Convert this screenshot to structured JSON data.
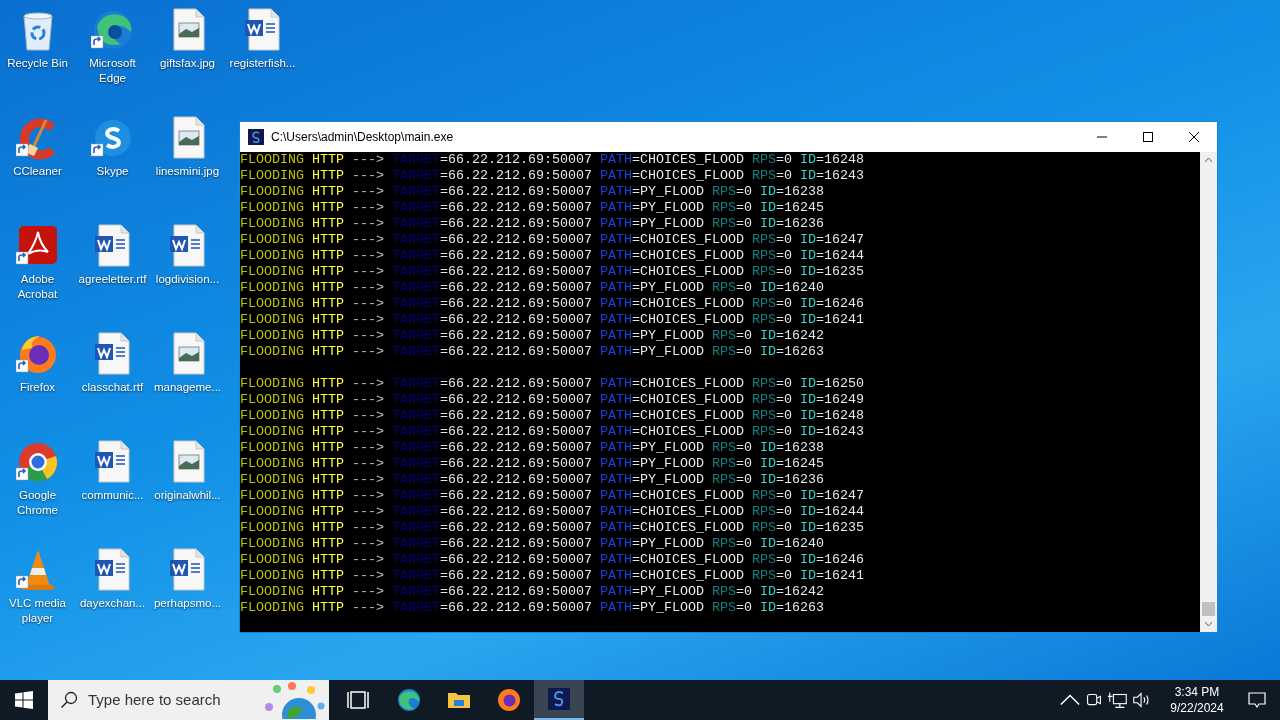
{
  "desktop_icons": [
    {
      "label": "Recycle Bin",
      "kind": "recycle",
      "shortcut": false
    },
    {
      "label": "CCleaner",
      "kind": "ccleaner",
      "shortcut": true
    },
    {
      "label": "Adobe Acrobat",
      "kind": "pdf",
      "shortcut": true
    },
    {
      "label": "Firefox",
      "kind": "firefox",
      "shortcut": true
    },
    {
      "label": "Google Chrome",
      "kind": "chrome",
      "shortcut": true
    },
    {
      "label": "VLC media player",
      "kind": "vlc",
      "shortcut": true
    },
    {
      "label": "Microsoft Edge",
      "kind": "edge",
      "shortcut": true
    },
    {
      "label": "Skype",
      "kind": "skype",
      "shortcut": true
    },
    {
      "label": "agreeletter.rtf",
      "kind": "word",
      "shortcut": false
    },
    {
      "label": "classchat.rtf",
      "kind": "word",
      "shortcut": false
    },
    {
      "label": "communic...",
      "kind": "word",
      "shortcut": false
    },
    {
      "label": "dayexchan...",
      "kind": "word",
      "shortcut": false
    },
    {
      "label": "giftsfax.jpg",
      "kind": "image",
      "shortcut": false
    },
    {
      "label": "linesmini.jpg",
      "kind": "image",
      "shortcut": false
    },
    {
      "label": "logdivision...",
      "kind": "word",
      "shortcut": false
    },
    {
      "label": "manageme...",
      "kind": "image",
      "shortcut": false
    },
    {
      "label": "originalwhil...",
      "kind": "image",
      "shortcut": false
    },
    {
      "label": "perhapsmo...",
      "kind": "word",
      "shortcut": false
    },
    {
      "label": "registerfish...",
      "kind": "word",
      "shortcut": false
    }
  ],
  "console_window": {
    "title": "C:\\Users\\admin\\Desktop\\main.exe",
    "buttons": [
      {
        "kind": "minimize"
      },
      {
        "kind": "maximize"
      },
      {
        "kind": "close"
      }
    ],
    "lines": [
      {
        "kind": "text",
        "parts": [
          "FLOODING",
          "HTTP",
          "--->",
          "TARGET",
          "=66.22.212.69:50007",
          "PATH",
          "=CHOICES_FLOOD",
          "RPS",
          "=0",
          "ID",
          "=16248"
        ]
      },
      {
        "kind": "text",
        "parts": [
          "FLOODING",
          "HTTP",
          "--->",
          "TARGET",
          "=66.22.212.69:50007",
          "PATH",
          "=CHOICES_FLOOD",
          "RPS",
          "=0",
          "ID",
          "=16243"
        ]
      },
      {
        "kind": "text",
        "parts": [
          "FLOODING",
          "HTTP",
          "--->",
          "TARGET",
          "=66.22.212.69:50007",
          "PATH",
          "=PY_FLOOD",
          "RPS",
          "=0",
          "ID",
          "=16238"
        ]
      },
      {
        "kind": "text",
        "parts": [
          "FLOODING",
          "HTTP",
          "--->",
          "TARGET",
          "=66.22.212.69:50007",
          "PATH",
          "=PY_FLOOD",
          "RPS",
          "=0",
          "ID",
          "=16245"
        ]
      },
      {
        "kind": "text",
        "parts": [
          "FLOODING",
          "HTTP",
          "--->",
          "TARGET",
          "=66.22.212.69:50007",
          "PATH",
          "=PY_FLOOD",
          "RPS",
          "=0",
          "ID",
          "=16236"
        ]
      },
      {
        "kind": "text",
        "parts": [
          "FLOODING",
          "HTTP",
          "--->",
          "TARGET",
          "=66.22.212.69:50007",
          "PATH",
          "=CHOICES_FLOOD",
          "RPS",
          "=0",
          "ID",
          "=16247"
        ]
      },
      {
        "kind": "text",
        "parts": [
          "FLOODING",
          "HTTP",
          "--->",
          "TARGET",
          "=66.22.212.69:50007",
          "PATH",
          "=CHOICES_FLOOD",
          "RPS",
          "=0",
          "ID",
          "=16244"
        ]
      },
      {
        "kind": "text",
        "parts": [
          "FLOODING",
          "HTTP",
          "--->",
          "TARGET",
          "=66.22.212.69:50007",
          "PATH",
          "=CHOICES_FLOOD",
          "RPS",
          "=0",
          "ID",
          "=16235"
        ]
      },
      {
        "kind": "text",
        "parts": [
          "FLOODING",
          "HTTP",
          "--->",
          "TARGET",
          "=66.22.212.69:50007",
          "PATH",
          "=PY_FLOOD",
          "RPS",
          "=0",
          "ID",
          "=16240"
        ]
      },
      {
        "kind": "text",
        "parts": [
          "FLOODING",
          "HTTP",
          "--->",
          "TARGET",
          "=66.22.212.69:50007",
          "PATH",
          "=CHOICES_FLOOD",
          "RPS",
          "=0",
          "ID",
          "=16246"
        ]
      },
      {
        "kind": "text",
        "parts": [
          "FLOODING",
          "HTTP",
          "--->",
          "TARGET",
          "=66.22.212.69:50007",
          "PATH",
          "=CHOICES_FLOOD",
          "RPS",
          "=0",
          "ID",
          "=16241"
        ]
      },
      {
        "kind": "text",
        "parts": [
          "FLOODING",
          "HTTP",
          "--->",
          "TARGET",
          "=66.22.212.69:50007",
          "PATH",
          "=PY_FLOOD",
          "RPS",
          "=0",
          "ID",
          "=16242"
        ]
      },
      {
        "kind": "text",
        "parts": [
          "FLOODING",
          "HTTP",
          "--->",
          "TARGET",
          "=66.22.212.69:50007",
          "PATH",
          "=PY_FLOOD",
          "RPS",
          "=0",
          "ID",
          "=16263"
        ]
      },
      {
        "kind": "blank"
      },
      {
        "kind": "text",
        "parts": [
          "FLOODING",
          "HTTP",
          "--->",
          "TARGET",
          "=66.22.212.69:50007",
          "PATH",
          "=CHOICES_FLOOD",
          "RPS",
          "=0",
          "ID",
          "=16250"
        ]
      },
      {
        "kind": "text",
        "parts": [
          "FLOODING",
          "HTTP",
          "--->",
          "TARGET",
          "=66.22.212.69:50007",
          "PATH",
          "=CHOICES_FLOOD",
          "RPS",
          "=0",
          "ID",
          "=16249"
        ]
      },
      {
        "kind": "text",
        "parts": [
          "FLOODING",
          "HTTP",
          "--->",
          "TARGET",
          "=66.22.212.69:50007",
          "PATH",
          "=CHOICES_FLOOD",
          "RPS",
          "=0",
          "ID",
          "=16248"
        ]
      },
      {
        "kind": "text",
        "parts": [
          "FLOODING",
          "HTTP",
          "--->",
          "TARGET",
          "=66.22.212.69:50007",
          "PATH",
          "=CHOICES_FLOOD",
          "RPS",
          "=0",
          "ID",
          "=16243"
        ]
      },
      {
        "kind": "text",
        "parts": [
          "FLOODING",
          "HTTP",
          "--->",
          "TARGET",
          "=66.22.212.69:50007",
          "PATH",
          "=PY_FLOOD",
          "RPS",
          "=0",
          "ID",
          "=16238"
        ]
      },
      {
        "kind": "text",
        "parts": [
          "FLOODING",
          "HTTP",
          "--->",
          "TARGET",
          "=66.22.212.69:50007",
          "PATH",
          "=PY_FLOOD",
          "RPS",
          "=0",
          "ID",
          "=16245"
        ]
      },
      {
        "kind": "text",
        "parts": [
          "FLOODING",
          "HTTP",
          "--->",
          "TARGET",
          "=66.22.212.69:50007",
          "PATH",
          "=PY_FLOOD",
          "RPS",
          "=0",
          "ID",
          "=16236"
        ]
      },
      {
        "kind": "text",
        "parts": [
          "FLOODING",
          "HTTP",
          "--->",
          "TARGET",
          "=66.22.212.69:50007",
          "PATH",
          "=CHOICES_FLOOD",
          "RPS",
          "=0",
          "ID",
          "=16247"
        ]
      },
      {
        "kind": "text",
        "parts": [
          "FLOODING",
          "HTTP",
          "--->",
          "TARGET",
          "=66.22.212.69:50007",
          "PATH",
          "=CHOICES_FLOOD",
          "RPS",
          "=0",
          "ID",
          "=16244"
        ]
      },
      {
        "kind": "text",
        "parts": [
          "FLOODING",
          "HTTP",
          "--->",
          "TARGET",
          "=66.22.212.69:50007",
          "PATH",
          "=CHOICES_FLOOD",
          "RPS",
          "=0",
          "ID",
          "=16235"
        ]
      },
      {
        "kind": "text",
        "parts": [
          "FLOODING",
          "HTTP",
          "--->",
          "TARGET",
          "=66.22.212.69:50007",
          "PATH",
          "=PY_FLOOD",
          "RPS",
          "=0",
          "ID",
          "=16240"
        ]
      },
      {
        "kind": "text",
        "parts": [
          "FLOODING",
          "HTTP",
          "--->",
          "TARGET",
          "=66.22.212.69:50007",
          "PATH",
          "=CHOICES_FLOOD",
          "RPS",
          "=0",
          "ID",
          "=16246"
        ]
      },
      {
        "kind": "text",
        "parts": [
          "FLOODING",
          "HTTP",
          "--->",
          "TARGET",
          "=66.22.212.69:50007",
          "PATH",
          "=CHOICES_FLOOD",
          "RPS",
          "=0",
          "ID",
          "=16241"
        ]
      },
      {
        "kind": "text",
        "parts": [
          "FLOODING",
          "HTTP",
          "--->",
          "TARGET",
          "=66.22.212.69:50007",
          "PATH",
          "=PY_FLOOD",
          "RPS",
          "=0",
          "ID",
          "=16242"
        ]
      },
      {
        "kind": "text",
        "parts": [
          "FLOODING",
          "HTTP",
          "--->",
          "TARGET",
          "=66.22.212.69:50007",
          "PATH",
          "=PY_FLOOD",
          "RPS",
          "=0",
          "ID",
          "=16263"
        ]
      }
    ]
  },
  "taskbar": {
    "search": {
      "placeholder": "Type here to search"
    },
    "apps": [
      {
        "kind": "taskview",
        "selected": false
      },
      {
        "kind": "edge",
        "selected": false
      },
      {
        "kind": "explorer",
        "selected": false
      },
      {
        "kind": "firefox",
        "selected": false
      },
      {
        "kind": "console",
        "selected": true
      }
    ],
    "tray_icons": [
      {
        "kind": "chevron"
      },
      {
        "kind": "camera"
      },
      {
        "kind": "network"
      },
      {
        "kind": "volume"
      }
    ],
    "time": "3:34 PM",
    "date": "9/22/2024"
  }
}
